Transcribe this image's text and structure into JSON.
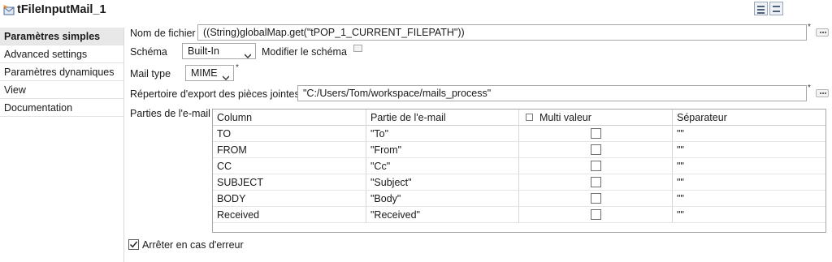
{
  "title": {
    "text": "tFileInputMail_1",
    "icon": "mail-component-icon"
  },
  "toolbar": {
    "icons": [
      "list-view-icon",
      "split-view-icon"
    ]
  },
  "sidebar": {
    "items": [
      {
        "label": "Paramètres simples",
        "active": true
      },
      {
        "label": "Advanced settings",
        "active": false
      },
      {
        "label": "Paramètres dynamiques",
        "active": false
      },
      {
        "label": "View",
        "active": false
      },
      {
        "label": "Documentation",
        "active": false
      }
    ]
  },
  "form": {
    "file_name_label": "Nom de fichier",
    "file_name_value": "((String)globalMap.get(\"tPOP_1_CURRENT_FILEPATH\"))",
    "schema_label": "Schéma",
    "schema_value": "Built-In",
    "modify_schema_label": "Modifier le schéma",
    "mail_type_label": "Mail type",
    "mail_type_value": "MIME",
    "export_dir_label": "Répertoire d'export des pièces jointes",
    "export_dir_value": "\"C:/Users/Tom/workspace/mails_process\"",
    "parts_label": "Parties de l'e-mail",
    "required_mark": "*",
    "stop_on_error_label": "Arrêter en cas d'erreur",
    "stop_on_error_checked": true
  },
  "mail_parts_table": {
    "headers": {
      "column": "Column",
      "part": "Partie de l'e-mail",
      "multi": "Multi valeur",
      "separator": "Séparateur"
    },
    "rows": [
      {
        "column": "TO",
        "part": "\"To\"",
        "multi": false,
        "separator": "\"\""
      },
      {
        "column": "FROM",
        "part": "\"From\"",
        "multi": false,
        "separator": "\"\""
      },
      {
        "column": "CC",
        "part": "\"Cc\"",
        "multi": false,
        "separator": "\"\""
      },
      {
        "column": "SUBJECT",
        "part": "\"Subject\"",
        "multi": false,
        "separator": "\"\""
      },
      {
        "column": "BODY",
        "part": "\"Body\"",
        "multi": false,
        "separator": "\"\""
      },
      {
        "column": "Received",
        "part": "\"Received\"",
        "multi": false,
        "separator": "\"\""
      }
    ]
  }
}
